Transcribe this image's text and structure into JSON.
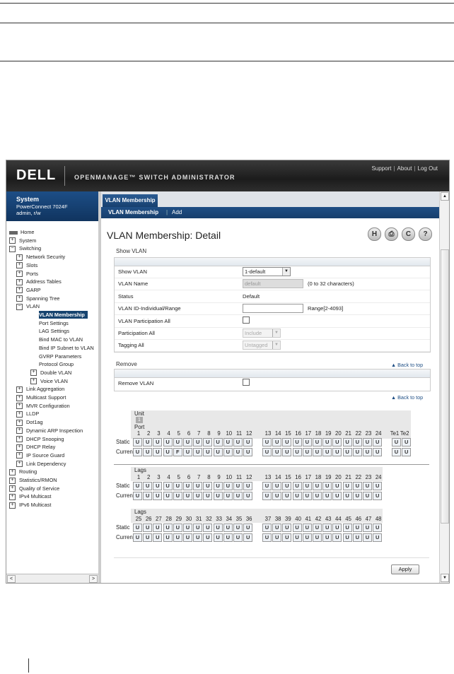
{
  "header": {
    "brand": "DELL",
    "app_title": "OPENMANAGE™ SWITCH ADMINISTRATOR",
    "links": [
      "Support",
      "About",
      "Log Out"
    ]
  },
  "system": {
    "title": "System",
    "model": "PowerConnect 7024F",
    "user": "admin, r/w"
  },
  "nav": [
    {
      "label": "Home",
      "level": 0,
      "icon": "home-icon"
    },
    {
      "label": "System",
      "level": 0,
      "icon": "plus"
    },
    {
      "label": "Switching",
      "level": 0,
      "icon": "minus"
    },
    {
      "label": "Network Security",
      "level": 1,
      "icon": "plus"
    },
    {
      "label": "Slots",
      "level": 1,
      "icon": "plus"
    },
    {
      "label": "Ports",
      "level": 1,
      "icon": "plus"
    },
    {
      "label": "Address Tables",
      "level": 1,
      "icon": "plus"
    },
    {
      "label": "GARP",
      "level": 1,
      "icon": "plus"
    },
    {
      "label": "Spanning Tree",
      "level": 1,
      "icon": "plus"
    },
    {
      "label": "VLAN",
      "level": 1,
      "icon": "minus"
    },
    {
      "label": "VLAN Membership",
      "level": 2,
      "icon": "none",
      "selected": true
    },
    {
      "label": "Port Settings",
      "level": 2,
      "icon": "none"
    },
    {
      "label": "LAG Settings",
      "level": 2,
      "icon": "none"
    },
    {
      "label": "Bind MAC to VLAN",
      "level": 2,
      "icon": "none"
    },
    {
      "label": "Bind IP Subnet to VLAN",
      "level": 2,
      "icon": "none"
    },
    {
      "label": "GVRP Parameters",
      "level": 2,
      "icon": "none"
    },
    {
      "label": "Protocol Group",
      "level": 2,
      "icon": "none"
    },
    {
      "label": "Double VLAN",
      "level": 2,
      "icon": "plus"
    },
    {
      "label": "Voice VLAN",
      "level": 2,
      "icon": "plus"
    },
    {
      "label": "Link Aggregation",
      "level": 1,
      "icon": "plus"
    },
    {
      "label": "Multicast Support",
      "level": 1,
      "icon": "plus"
    },
    {
      "label": "MVR Configuration",
      "level": 1,
      "icon": "plus"
    },
    {
      "label": "LLDP",
      "level": 1,
      "icon": "plus"
    },
    {
      "label": "Dot1ag",
      "level": 1,
      "icon": "plus"
    },
    {
      "label": "Dynamic ARP Inspection",
      "level": 1,
      "icon": "plus"
    },
    {
      "label": "DHCP Snooping",
      "level": 1,
      "icon": "plus"
    },
    {
      "label": "DHCP Relay",
      "level": 1,
      "icon": "plus"
    },
    {
      "label": "IP Source Guard",
      "level": 1,
      "icon": "plus"
    },
    {
      "label": "Link Dependency",
      "level": 1,
      "icon": "plus"
    },
    {
      "label": "Routing",
      "level": 0,
      "icon": "plus"
    },
    {
      "label": "Statistics/RMON",
      "level": 0,
      "icon": "plus"
    },
    {
      "label": "Quality of Service",
      "level": 0,
      "icon": "plus"
    },
    {
      "label": "IPv4 Multicast",
      "level": 0,
      "icon": "plus"
    },
    {
      "label": "IPv6 Multicast",
      "level": 0,
      "icon": "plus"
    }
  ],
  "tabs": {
    "active": "VLAN Membership",
    "sub": [
      "VLAN Membership",
      "Add"
    ]
  },
  "page": {
    "title": "VLAN Membership: Detail",
    "toolbar_icons": [
      "save-icon",
      "print-icon",
      "refresh-icon",
      "help-icon"
    ]
  },
  "show_vlan": {
    "section": "Show VLAN",
    "rows": [
      {
        "label": "Show VLAN",
        "value": "1-default",
        "kind": "select"
      },
      {
        "label": "VLAN Name",
        "value": "default",
        "kind": "disabled-input",
        "hint": "(0 to 32 characters)"
      },
      {
        "label": "Status",
        "value": "Default",
        "kind": "text"
      },
      {
        "label": "VLAN ID-Individual/Range",
        "value": "",
        "kind": "input",
        "hint": "Range[2-4093]"
      },
      {
        "label": "VLAN Participation All",
        "value": "",
        "kind": "checkbox"
      },
      {
        "label": "Participation All",
        "value": "Include",
        "kind": "disabled-select"
      },
      {
        "label": "Tagging All",
        "value": "Untagged",
        "kind": "disabled-select"
      }
    ]
  },
  "remove": {
    "section": "Remove",
    "label": "Remove VLAN",
    "back_to_top": "Back to top"
  },
  "ports": {
    "unit_label": "Unit",
    "unit_value": "1",
    "port_label": "Port",
    "static_label": "Static",
    "current_label": "Current",
    "group1": [
      "1",
      "2",
      "3",
      "4",
      "5",
      "6",
      "7",
      "8",
      "9",
      "10",
      "11",
      "12"
    ],
    "group2": [
      "13",
      "14",
      "15",
      "16",
      "17",
      "18",
      "19",
      "20",
      "21",
      "22",
      "23",
      "24"
    ],
    "te": [
      "Te1",
      "Te2"
    ],
    "static": [
      "U",
      "U",
      "U",
      "U",
      "U",
      "U",
      "U",
      "U",
      "U",
      "U",
      "U",
      "U",
      "U",
      "U",
      "U",
      "U",
      "U",
      "U",
      "U",
      "U",
      "U",
      "U",
      "U",
      "U",
      "U",
      "U"
    ],
    "current": [
      "U",
      "U",
      "U",
      "U",
      "F",
      "U",
      "U",
      "U",
      "U",
      "U",
      "U",
      "U",
      "U",
      "U",
      "U",
      "U",
      "U",
      "U",
      "U",
      "U",
      "U",
      "U",
      "U",
      "U",
      "U",
      "U"
    ]
  },
  "lags1": {
    "label": "Lags",
    "group1": [
      "1",
      "2",
      "3",
      "4",
      "5",
      "6",
      "7",
      "8",
      "9",
      "10",
      "11",
      "12"
    ],
    "group2": [
      "13",
      "14",
      "15",
      "16",
      "17",
      "18",
      "19",
      "20",
      "21",
      "22",
      "23",
      "24"
    ],
    "static": "U",
    "current": "U"
  },
  "lags2": {
    "label": "Lags",
    "group1": [
      "25",
      "26",
      "27",
      "28",
      "29",
      "30",
      "31",
      "32",
      "33",
      "34",
      "35",
      "36"
    ],
    "group2": [
      "37",
      "38",
      "39",
      "40",
      "41",
      "42",
      "43",
      "44",
      "45",
      "46",
      "47",
      "48"
    ],
    "static": "U",
    "current": "U"
  },
  "apply_label": "Apply"
}
